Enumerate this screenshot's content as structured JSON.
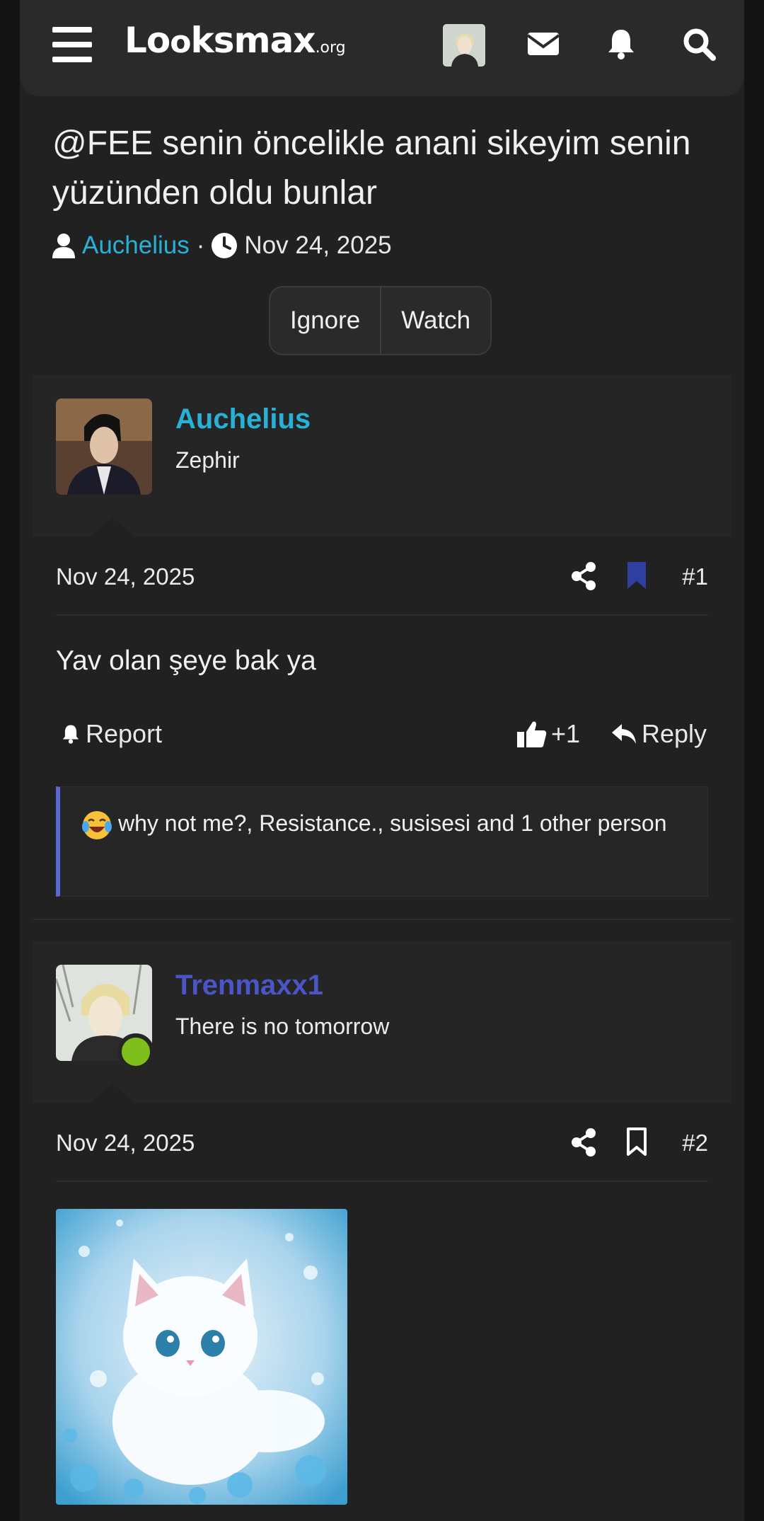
{
  "header": {
    "logo_main": "Lo",
    "logo_rest": "ksmax",
    "logo_tld": ".org",
    "icons": [
      "hamburger-menu-icon",
      "envelope-icon",
      "bell-icon",
      "search-icon"
    ]
  },
  "thread": {
    "title": "@FEE senin öncelikle anani sikeyim senin yüzünden oldu bunlar",
    "author": "Auchelius",
    "separator": "·",
    "date": "Nov 24, 2025",
    "buttons": {
      "ignore": "Ignore",
      "watch": "Watch"
    }
  },
  "posts": [
    {
      "username": "Auchelius",
      "user_title": "Zephir",
      "username_color": "#29b0d6",
      "date": "Nov 24, 2025",
      "number": "#1",
      "bookmarked": true,
      "body": "Yav olan şeye bak ya",
      "report_label": "Report",
      "like_count": "+1",
      "reply_label": "Reply",
      "reactions_text": "why not me?, Resistance., susisesi and 1 other person"
    },
    {
      "username": "Trenmaxx1",
      "user_title": "There is no tomorrow",
      "username_color": "#4a55c8",
      "online": true,
      "date": "Nov 24, 2025",
      "number": "#2",
      "bookmarked": false,
      "image_description": "white-kitten-image"
    }
  ],
  "colors": {
    "link": "#29b0d6",
    "bookmark_active": "#2f3fa0",
    "online": "#7fbf1c",
    "reaction_border": "#5a67d8"
  }
}
